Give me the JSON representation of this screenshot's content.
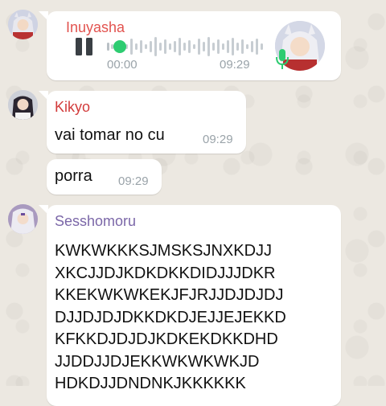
{
  "chat": {
    "messages": [
      {
        "sender": "Inuyasha",
        "type": "voice",
        "elapsed": "00:00",
        "time": "09:29",
        "name_color": "#e2534f"
      },
      {
        "sender": "Kikyo",
        "type": "text",
        "text": "vai tomar no cu",
        "time": "09:29",
        "name_color": "#d23b3b"
      },
      {
        "sender": "",
        "type": "text",
        "text": "porra",
        "time": "09:29"
      },
      {
        "sender": "Sesshomoru",
        "type": "text",
        "name_color": "#7b67a8",
        "lines": [
          "KWKWKKKSJMSKSJNXKDJJ",
          "XKCJJDJKDKDKKDIDJJJDKR",
          "KKEKWKWKEKJFJRJJDJDJDJ",
          "DJJDJDJDKKDKDJEJJEJEKKD",
          "KFKKDJDJDJKDKEKDKKDHD",
          "JJDDJJDJEKKWKWKWKJD",
          "HDKDJJDNDNKJKKKKKK"
        ]
      }
    ]
  },
  "icons": {
    "pause": "pause-icon",
    "mic": "microphone-icon"
  },
  "colors": {
    "accent_green": "#2ecc71",
    "waveform": "#c7cdd2",
    "time_gray": "#9aa3a9"
  }
}
